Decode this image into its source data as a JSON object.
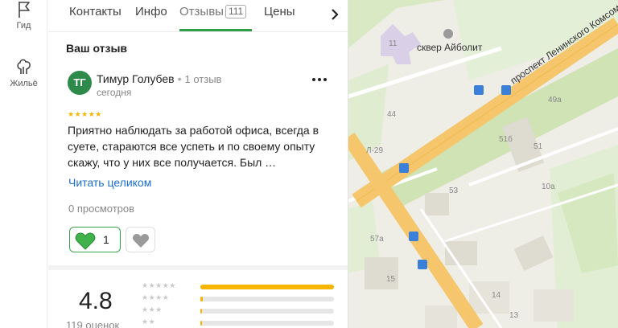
{
  "rail": {
    "items": [
      {
        "label": "Гид",
        "icon": "flag-icon"
      },
      {
        "label": "Жильё",
        "icon": "tree-icon"
      }
    ]
  },
  "tabs": [
    {
      "label": "Контакты"
    },
    {
      "label": "Инфо"
    },
    {
      "label": "Отзывы",
      "count": "111",
      "active": true
    },
    {
      "label": "Цены"
    }
  ],
  "review": {
    "section_title": "Ваш отзыв",
    "avatar_initials": "ТГ",
    "author": "Тимур Голубев",
    "author_reviews": "1 отзыв",
    "date": "сегодня",
    "stars": "★★★★★",
    "text": "Приятно наблюдать за работой офиса, всегда в суете, стараются все успеть и по своему опыту скажу, что у них все получается. Был …",
    "read_more": "Читать целиком",
    "views": "0 просмотров",
    "likes": "1"
  },
  "rating": {
    "value": "4.8",
    "count_label": "119 оценок",
    "bars": [
      {
        "stars": "★★★★★",
        "fraction": 1.0
      },
      {
        "stars": "★★★★",
        "fraction": 0.02
      },
      {
        "stars": "★★★",
        "fraction": 0.01
      },
      {
        "stars": "★★",
        "fraction": 0.01
      }
    ]
  },
  "map": {
    "street_label": "проспект Ленинского Комсомола",
    "poi_label": "сквер Айболит",
    "house_numbers": [
      "11",
      "44",
      "49а",
      "51б",
      "51",
      "Л-29",
      "53",
      "10а",
      "57а",
      "15",
      "14",
      "13"
    ],
    "colors": {
      "background": "#eeede6",
      "road": "#f5c66b",
      "green": "#cfe3b5",
      "building": "#dedbd1"
    }
  }
}
